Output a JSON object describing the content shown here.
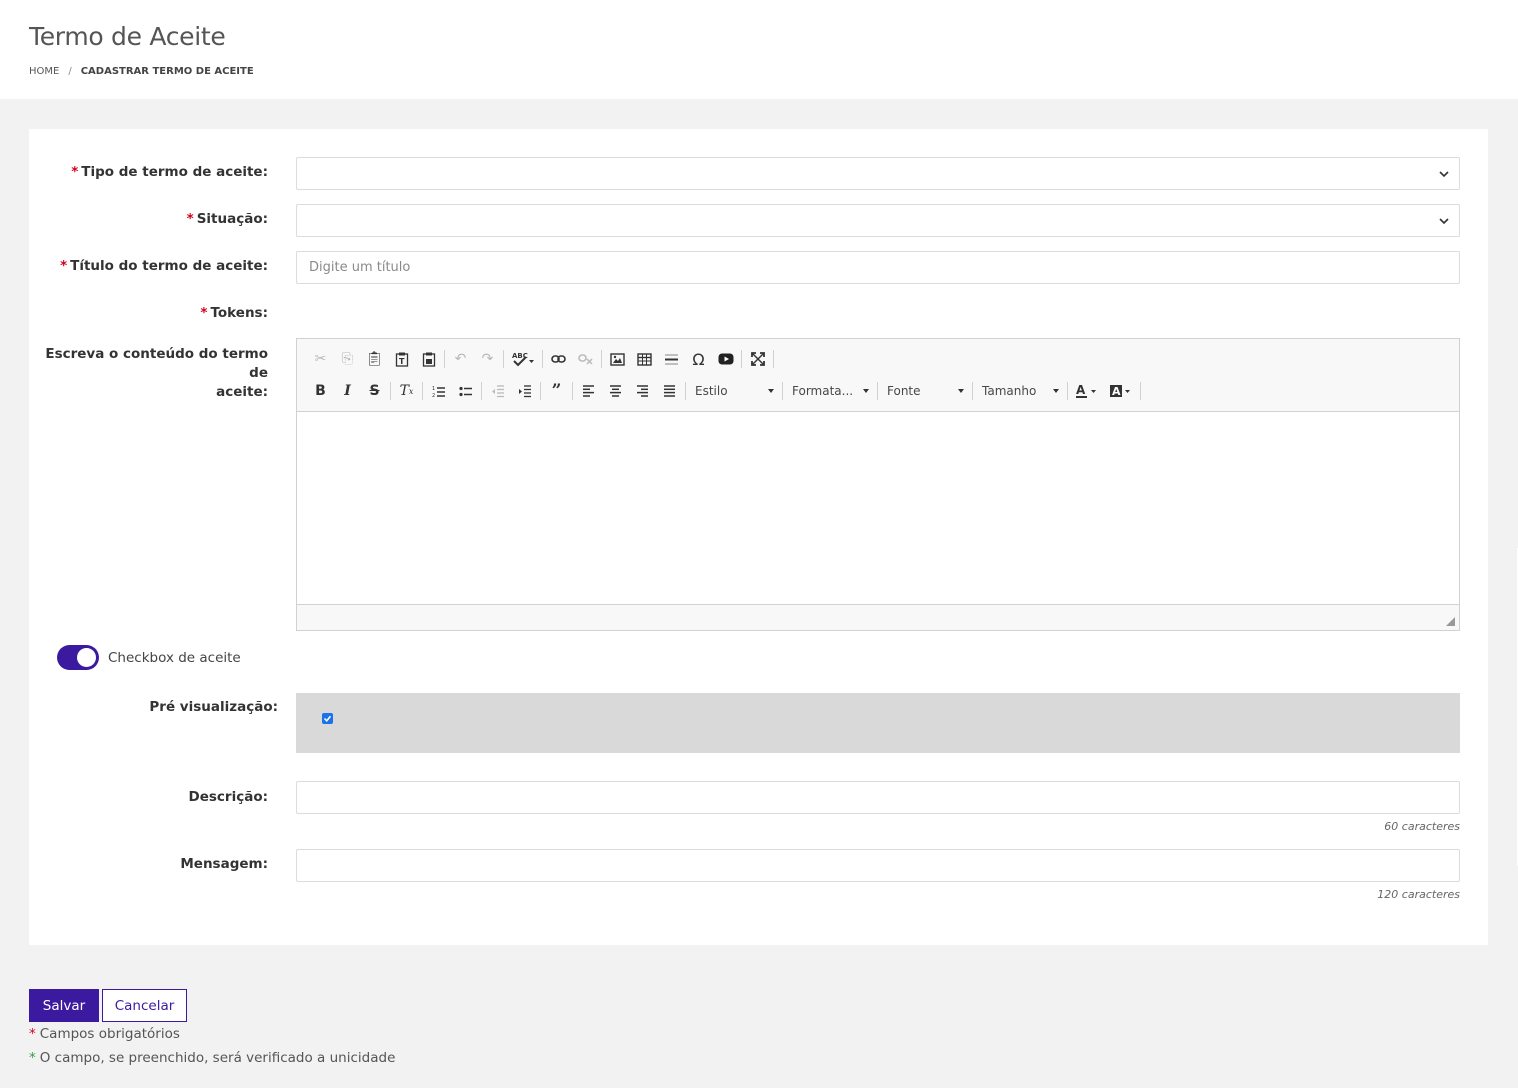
{
  "header": {
    "title": "Termo de Aceite",
    "breadcrumb": {
      "home": "HOME",
      "separator": "/",
      "current": "CADASTRAR TERMO DE ACEITE"
    }
  },
  "form": {
    "required_mark": "*",
    "tipo": {
      "label": "Tipo de termo de aceite:",
      "value": ""
    },
    "situacao": {
      "label": "Situação:",
      "value": ""
    },
    "titulo": {
      "label": "Título do termo de aceite:",
      "placeholder": "Digite um título",
      "value": ""
    },
    "tokens": {
      "label": "Tokens:"
    },
    "conteudo": {
      "label_line1": "Escreva o conteúdo do termo de",
      "label_line2": "aceite:",
      "combos": {
        "estilo": "Estilo",
        "formata": "Formata...",
        "fonte": "Fonte",
        "tamanho": "Tamanho"
      },
      "icons_row1": [
        "cut-icon",
        "copy-icon",
        "paste-icon",
        "paste-text-icon",
        "paste-word-icon",
        "undo-icon",
        "redo-icon",
        "spellcheck-icon",
        "link-icon",
        "unlink-icon",
        "image-icon",
        "table-icon",
        "horizontal-line-icon",
        "special-char-icon",
        "youtube-icon",
        "maximize-icon"
      ],
      "icons_row2": [
        "bold-icon",
        "italic-icon",
        "strike-icon",
        "remove-format-icon",
        "numbered-list-icon",
        "bulleted-list-icon",
        "outdent-icon",
        "indent-icon",
        "blockquote-icon",
        "align-left-icon",
        "align-center-icon",
        "align-right-icon",
        "align-justify-icon",
        "text-color-icon",
        "bg-color-icon"
      ]
    },
    "checkbox_aceite": {
      "label": "Checkbox de aceite",
      "enabled": true
    },
    "pre_visualizacao": {
      "label": "Pré visualização:",
      "checked": true
    },
    "descricao": {
      "label": "Descrição:",
      "value": "",
      "counter": "60 caracteres"
    },
    "mensagem": {
      "label": "Mensagem:",
      "value": "",
      "counter": "120 caracteres"
    }
  },
  "actions": {
    "save": "Salvar",
    "cancel": "Cancelar"
  },
  "notes": {
    "required": "Campos obrigatórios",
    "unique": "O campo, se preenchido, será verificado a unicidade",
    "star": "*"
  },
  "colors": {
    "accent": "#3c1aa0",
    "required": "#d0021b",
    "unique": "#2e9e3e"
  }
}
